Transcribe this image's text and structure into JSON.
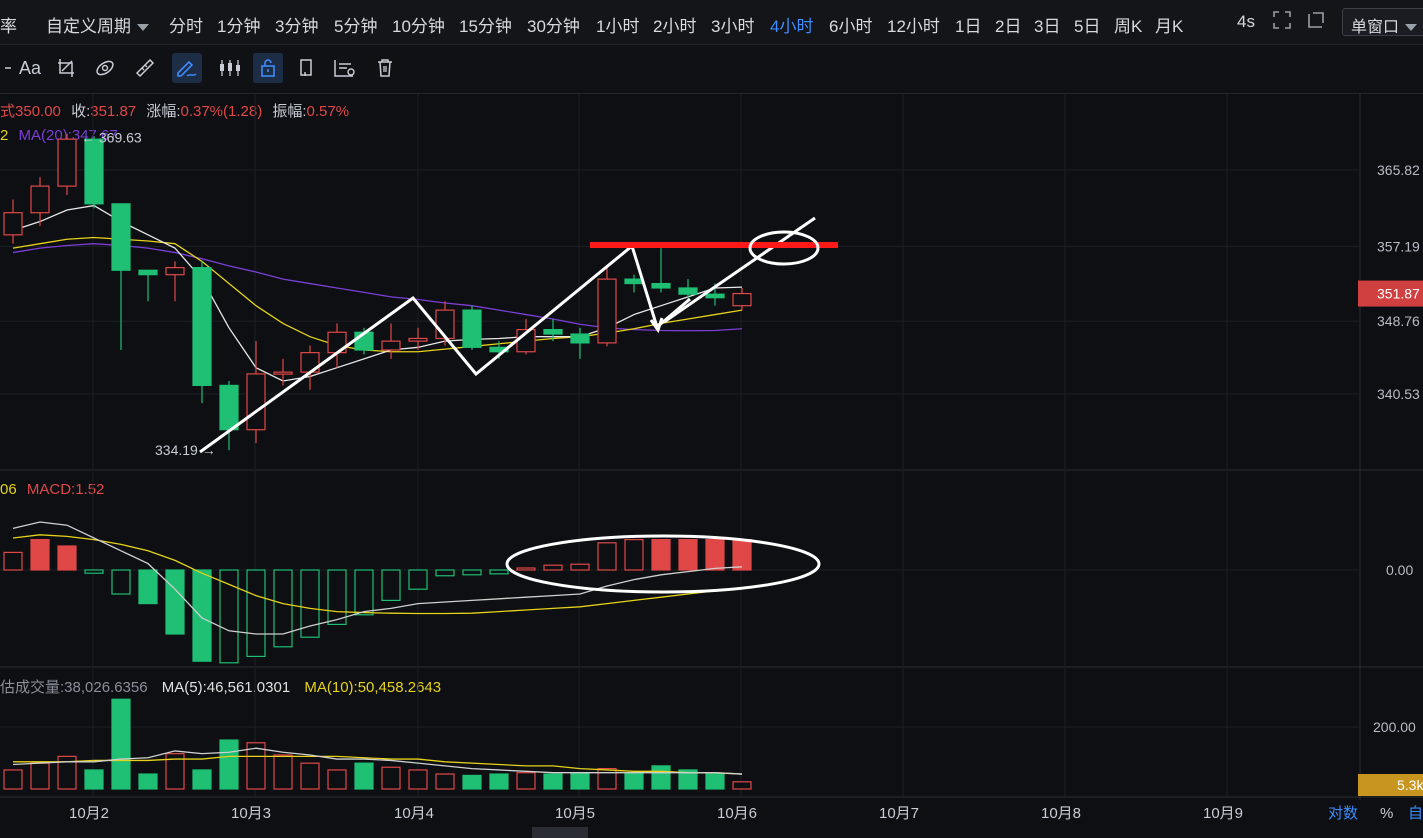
{
  "topbar": {
    "left_clip": "率",
    "custom_period": "自定义周期",
    "timeframes": [
      "分时",
      "1分钟",
      "3分钟",
      "5分钟",
      "10分钟",
      "15分钟",
      "30分钟",
      "1小时",
      "2小时",
      "3小时",
      "4小时",
      "6小时",
      "12小时",
      "1日",
      "2日",
      "3日",
      "5日",
      "周K",
      "月K"
    ],
    "active_timeframe": "4小时",
    "refresh": "4s",
    "window_mode": "单窗口"
  },
  "toolbar": {
    "font_label": "Aa",
    "icons": [
      "crop-icon",
      "fib-icon",
      "eraser-icon",
      "ruler-icon",
      "draw-trend-icon",
      "candle-settings-icon",
      "lock-icon",
      "copy-icon",
      "chart-settings-icon",
      "delete-icon"
    ]
  },
  "info_line": {
    "open_label": "开:",
    "open": "350.00",
    "close_label": "收:",
    "close": "351.87",
    "change_label": "涨幅:",
    "change": "0.37%(1.28)",
    "amp_label": "振幅:",
    "amp": "0.57%"
  },
  "ma_legend": {
    "prefix": "2",
    "text": "MA(20):347.67"
  },
  "macd_legend": {
    "prefix": "06",
    "text": "MACD:1.52"
  },
  "vol_legend": {
    "label": "估成交量:38,026.6356",
    "ma5": "MA(5):46,561.0301",
    "ma10": "MA(10):50,458.2643"
  },
  "colors": {
    "up": "#e04848",
    "down": "#1fbf74",
    "ma5": "#e8e8e8",
    "ma10": "#e6d21a",
    "ma20": "#7b3fd6",
    "accent": "#3d8bfd",
    "annotation_line": "#ff1a1a"
  },
  "chart_data": {
    "type": "candlestick",
    "x_labels": [
      "10月2",
      "10月3",
      "10月4",
      "10月5",
      "10月6",
      "10月7",
      "10月8",
      "10月9"
    ],
    "price_axis": {
      "ticks": [
        365.82,
        357.19,
        348.76,
        340.53
      ],
      "current": "351.87"
    },
    "macd_axis": {
      "ticks": [
        "0.00"
      ]
    },
    "volume_axis": {
      "ticks": [
        "200.00"
      ],
      "current": "5.3k"
    },
    "high_marker": "369.63",
    "low_marker": "334.19",
    "candles": [
      {
        "o": 358.5,
        "c": 361.0,
        "h": 362.5,
        "l": 357.5
      },
      {
        "o": 361.0,
        "c": 364.0,
        "h": 365.0,
        "l": 359.5
      },
      {
        "o": 364.0,
        "c": 369.3,
        "h": 369.9,
        "l": 363.0
      },
      {
        "o": 369.3,
        "c": 362.0,
        "h": 369.63,
        "l": 361.5
      },
      {
        "o": 362.0,
        "c": 354.5,
        "h": 362.0,
        "l": 345.5
      },
      {
        "o": 354.5,
        "c": 354.0,
        "h": 354.5,
        "l": 351.0
      },
      {
        "o": 354.0,
        "c": 354.8,
        "h": 355.5,
        "l": 351.0
      },
      {
        "o": 354.8,
        "c": 341.5,
        "h": 355.5,
        "l": 339.5
      },
      {
        "o": 341.5,
        "c": 336.5,
        "h": 342.0,
        "l": 334.19
      },
      {
        "o": 336.5,
        "c": 342.8,
        "h": 346.5,
        "l": 335.0
      },
      {
        "o": 342.8,
        "c": 343.0,
        "h": 344.5,
        "l": 341.5
      },
      {
        "o": 343.0,
        "c": 345.2,
        "h": 346.0,
        "l": 341.0
      },
      {
        "o": 345.2,
        "c": 347.5,
        "h": 348.5,
        "l": 343.5
      },
      {
        "o": 347.5,
        "c": 345.5,
        "h": 348.0,
        "l": 345.0
      },
      {
        "o": 345.5,
        "c": 346.5,
        "h": 348.5,
        "l": 344.5
      },
      {
        "o": 346.5,
        "c": 346.8,
        "h": 348.0,
        "l": 345.5
      },
      {
        "o": 346.8,
        "c": 350.0,
        "h": 351.0,
        "l": 346.0
      },
      {
        "o": 350.0,
        "c": 345.8,
        "h": 350.5,
        "l": 345.5
      },
      {
        "o": 345.8,
        "c": 345.3,
        "h": 346.5,
        "l": 344.5
      },
      {
        "o": 345.3,
        "c": 347.8,
        "h": 349.0,
        "l": 345.0
      },
      {
        "o": 347.8,
        "c": 347.3,
        "h": 349.0,
        "l": 346.5
      },
      {
        "o": 347.3,
        "c": 346.3,
        "h": 348.0,
        "l": 344.5
      },
      {
        "o": 346.3,
        "c": 353.5,
        "h": 355.0,
        "l": 345.9
      },
      {
        "o": 353.5,
        "c": 353.0,
        "h": 354.0,
        "l": 352.0
      },
      {
        "o": 353.0,
        "c": 352.5,
        "h": 357.0,
        "l": 352.0
      },
      {
        "o": 352.5,
        "c": 351.8,
        "h": 353.5,
        "l": 351.0
      },
      {
        "o": 351.8,
        "c": 351.4,
        "h": 353.0,
        "l": 350.5
      },
      {
        "o": 350.5,
        "c": 351.87,
        "h": 352.5,
        "l": 350.0
      }
    ],
    "ma5": [
      359.0,
      360.0,
      361.3,
      361.8,
      360.0,
      358.5,
      357.0,
      353.5,
      348.0,
      343.5,
      342.0,
      342.5,
      343.5,
      344.5,
      345.5,
      345.8,
      346.5,
      346.7,
      346.8,
      347.0,
      347.0,
      347.0,
      348.0,
      349.5,
      350.5,
      351.5,
      352.5,
      352.6
    ],
    "ma10": [
      357.0,
      357.5,
      358.0,
      358.2,
      358.0,
      357.8,
      357.5,
      355.5,
      353.0,
      350.5,
      348.5,
      347.0,
      346.0,
      345.5,
      345.3,
      345.3,
      345.6,
      345.9,
      346.2,
      346.5,
      346.8,
      347.0,
      347.4,
      347.9,
      348.5,
      349.0,
      349.5,
      350.0
    ],
    "ma20": [
      356.5,
      357.0,
      357.3,
      357.5,
      357.3,
      357.0,
      356.5,
      355.8,
      355.0,
      354.3,
      353.5,
      353.0,
      352.5,
      352.0,
      351.5,
      351.2,
      350.8,
      350.5,
      350.0,
      349.5,
      349.0,
      348.4,
      348.0,
      347.8,
      347.7,
      347.67,
      347.7,
      347.9
    ],
    "macd_hist": [
      0.55,
      0.95,
      0.75,
      -0.1,
      -0.75,
      -1.05,
      -2.0,
      -2.85,
      -2.9,
      -2.7,
      -2.4,
      -2.1,
      -1.7,
      -1.4,
      -0.95,
      -0.6,
      -0.18,
      -0.15,
      -0.12,
      0.05,
      0.15,
      0.18,
      0.85,
      0.95,
      0.95,
      0.95,
      0.95,
      0.95
    ],
    "dif": [
      1.3,
      1.5,
      1.4,
      1.0,
      0.6,
      0.2,
      -0.6,
      -1.5,
      -1.9,
      -2.0,
      -2.0,
      -1.75,
      -1.55,
      -1.3,
      -1.2,
      -1.05,
      -1.0,
      -0.95,
      -0.9,
      -0.85,
      -0.8,
      -0.75,
      -0.5,
      -0.3,
      -0.15,
      -0.05,
      0.05,
      0.1
    ],
    "dea": [
      1.0,
      1.1,
      1.05,
      0.95,
      0.8,
      0.6,
      0.3,
      -0.1,
      -0.45,
      -0.8,
      -1.05,
      -1.2,
      -1.3,
      -1.33,
      -1.35,
      -1.36,
      -1.36,
      -1.35,
      -1.3,
      -1.25,
      -1.2,
      -1.15,
      -1.05,
      -0.95,
      -0.85,
      -0.75,
      -0.65,
      -0.55
    ],
    "volume": [
      14,
      19,
      24,
      14,
      66,
      11,
      26,
      14,
      36,
      34,
      25,
      19,
      14,
      19,
      16,
      14,
      11,
      10,
      11,
      12,
      11,
      12,
      15,
      12,
      17,
      14,
      11,
      5.3
    ],
    "vol_ma5": [
      18,
      19,
      20,
      20,
      22,
      23,
      28,
      26,
      27,
      30,
      27,
      25,
      22,
      22,
      21,
      19,
      17,
      15,
      14,
      13,
      12,
      12,
      12,
      12,
      12,
      12,
      12,
      11
    ],
    "vol_ma10": [
      20,
      20,
      20,
      21,
      21,
      21,
      22,
      22,
      24,
      24,
      24,
      24,
      24,
      23,
      22,
      22,
      20,
      19,
      18,
      17,
      17,
      15,
      14,
      13,
      13,
      12,
      12,
      11
    ]
  }
}
